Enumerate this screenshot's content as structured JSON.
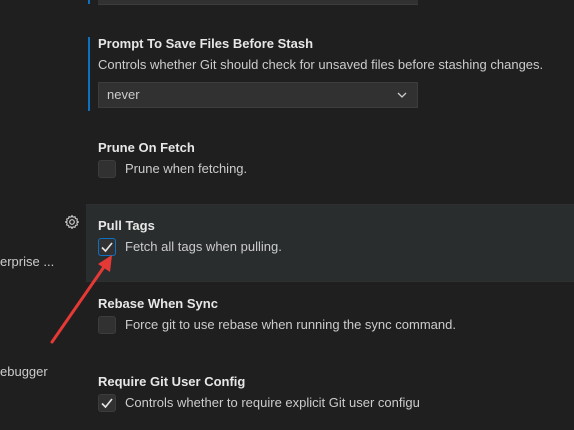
{
  "sidebar": {
    "item_enterprise": "erprise ...",
    "item_debugger": "ebugger"
  },
  "settings": {
    "prompt_save": {
      "title": "Prompt To Save Files Before Stash",
      "description": "Controls whether Git should check for unsaved files before stashing changes.",
      "value": "never"
    },
    "prune_on_fetch": {
      "title": "Prune On Fetch",
      "checkbox_label": "Prune when fetching.",
      "checked": false
    },
    "pull_tags": {
      "title": "Pull Tags",
      "checkbox_label": "Fetch all tags when pulling.",
      "checked": true
    },
    "rebase_when_sync": {
      "title": "Rebase When Sync",
      "checkbox_label": "Force git to use rebase when running the sync command.",
      "checked": false
    },
    "require_git_user_config": {
      "title": "Require Git User Config",
      "checkbox_label": "Controls whether to require explicit Git user configu",
      "checked": true
    }
  },
  "colors": {
    "background": "#1f1f1f",
    "focus_border": "#0e70c0",
    "annotation_arrow": "#e53935"
  },
  "icons": {
    "gear": "gear-icon",
    "chevron": "chevron-down-icon",
    "check": "check-icon"
  }
}
